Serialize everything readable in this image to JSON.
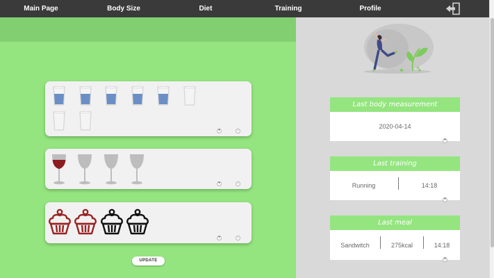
{
  "nav": {
    "items": [
      "Main Page",
      "Body Size",
      "Diet",
      "Training",
      "Profile"
    ]
  },
  "water": {
    "filled": 5,
    "total": 8,
    "controls": {
      "plus": "+",
      "minus": "-"
    }
  },
  "wine": {
    "filled": 1,
    "total": 4,
    "controls": {
      "plus": "+",
      "minus": "-"
    }
  },
  "sweets": {
    "filled": 2,
    "total": 4,
    "controls": {
      "plus": "+",
      "minus": "-"
    }
  },
  "update_label": "UPDATE",
  "cards": {
    "body": {
      "title": "Last body measurement",
      "date": "2020-04-14",
      "expand": "+"
    },
    "training": {
      "title": "Last training",
      "activity": "Running",
      "time": "14:18",
      "expand": "+"
    },
    "meal": {
      "title": "Last meal",
      "food": "Sandwitch",
      "calories": "275kcal",
      "time": "14:18",
      "expand": "+"
    }
  },
  "colors": {
    "accent": "#94e57f",
    "water": "#6b8fc4",
    "wine": "#8c1c20",
    "cupcake_filled": "#9b2323",
    "cupcake_empty": "#111111"
  }
}
